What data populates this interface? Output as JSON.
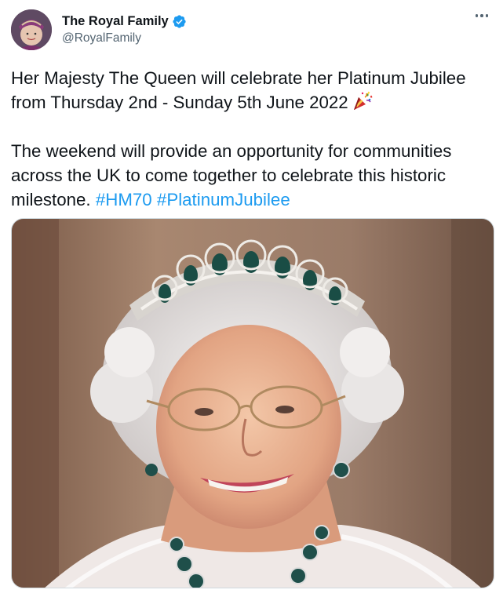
{
  "author": {
    "display_name": "The Royal Family",
    "handle": "@RoyalFamily",
    "verified": true,
    "verified_color": "#1d9bf0"
  },
  "tweet": {
    "paragraph1": "Her Majesty The Queen will celebrate her Platinum Jubilee from Thursday 2nd - Sunday 5th June 2022",
    "paragraph2_text": "The weekend will provide an opportunity for communities across the UK to come together to celebrate this historic milestone.",
    "hashtags": [
      "#HM70",
      "#PlatinumJubilee"
    ],
    "emoji": "party-popper-icon",
    "hashtag_color": "#1d9bf0"
  },
  "icons": {
    "more": "more-options-icon",
    "verified": "verified-badge-icon"
  }
}
